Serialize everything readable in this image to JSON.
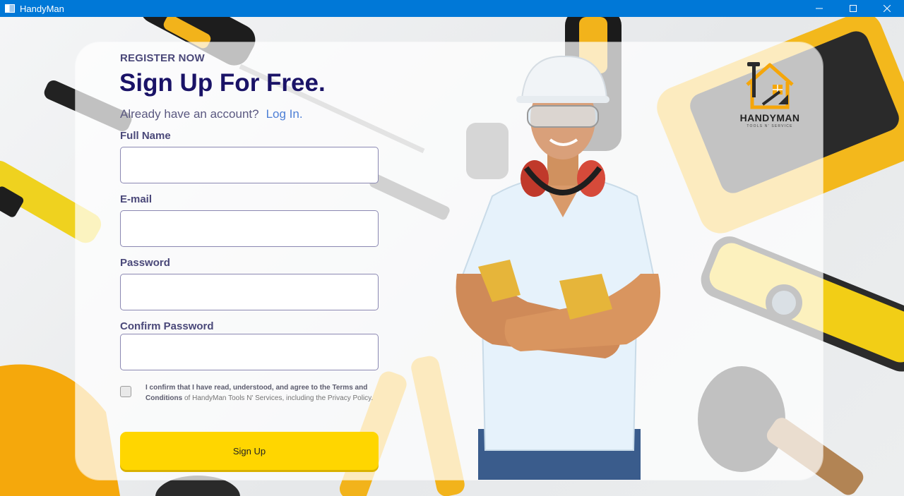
{
  "window": {
    "title": "HandyMan",
    "controls": [
      "minimize-icon",
      "maximize-icon",
      "close-icon"
    ]
  },
  "form": {
    "eyebrow": "REGISTER NOW",
    "headline": "Sign Up For Free.",
    "account_prompt": "Already have an account?",
    "login_link": "Log In.",
    "fields": [
      {
        "label": "Full Name",
        "value": "",
        "placeholder": ""
      },
      {
        "label": "E-mail",
        "value": "",
        "placeholder": ""
      },
      {
        "label": "Password",
        "value": "",
        "placeholder": ""
      },
      {
        "label": "Confirm Password",
        "value": "",
        "placeholder": ""
      }
    ],
    "terms": {
      "checked": false,
      "bold_text": "I confirm that I have read, understood, and agree to the Terms and Conditions",
      "rest_text": " of HandyMan Tools N' Services, including the Privacy Policy."
    },
    "submit_label": "Sign Up"
  },
  "logo": {
    "name": "HANDYMAN",
    "tagline": "TOOLS N' SERVICE"
  },
  "colors": {
    "titlebar": "#0078d7",
    "headline": "#1a1367",
    "link": "#4d7fd6",
    "button": "#ffd600"
  }
}
